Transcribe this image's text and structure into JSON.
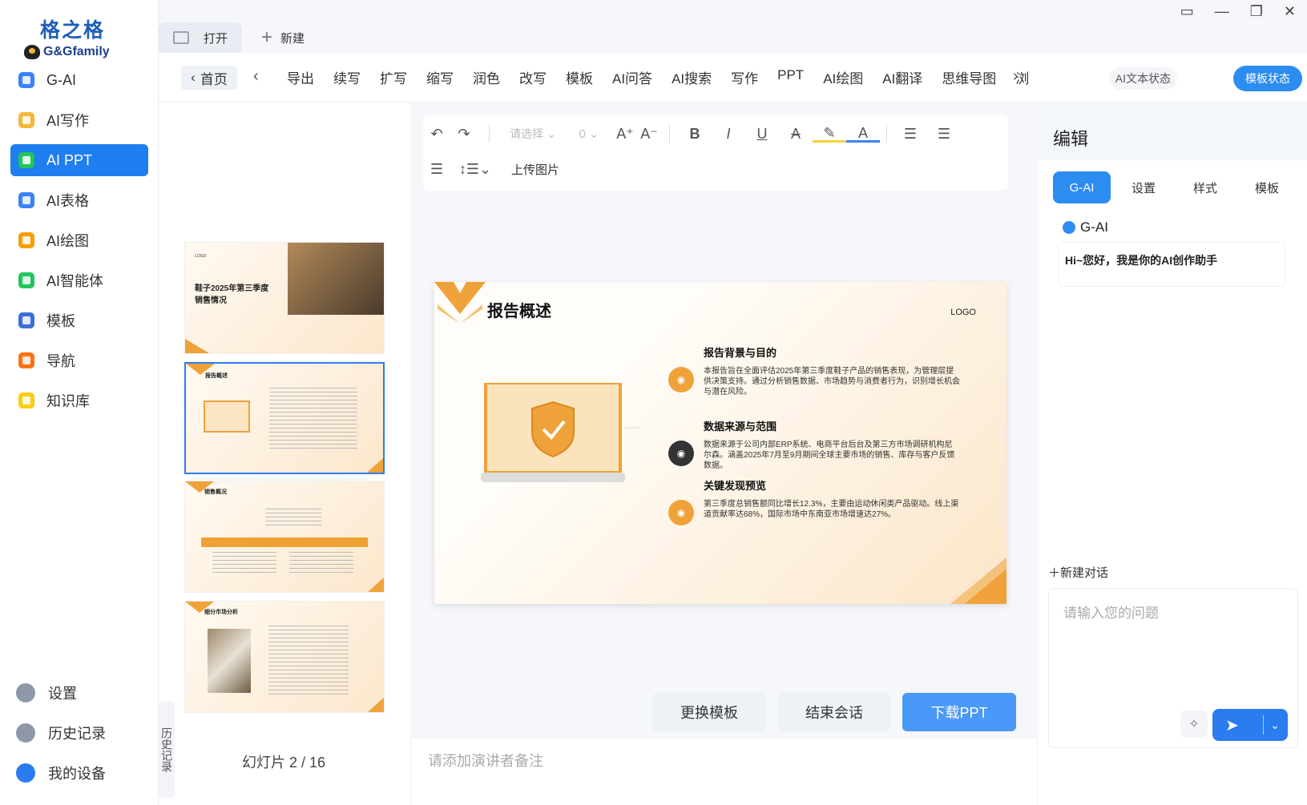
{
  "app": {
    "logo_cn": "格之格",
    "logo_en": "G&Gfamily"
  },
  "sidebar": {
    "items": [
      {
        "label": "G-AI",
        "icon": "g-ai-icon",
        "color": "#3b82f6"
      },
      {
        "label": "AI写作",
        "icon": "writing-icon",
        "color": "#f5b83d"
      },
      {
        "label": "AI PPT",
        "icon": "ppt-icon",
        "color": "#22c55e"
      },
      {
        "label": "AI表格",
        "icon": "table-icon",
        "color": "#3b82f6"
      },
      {
        "label": "AI绘图",
        "icon": "paint-icon",
        "color": "#f59e0b"
      },
      {
        "label": "AI智能体",
        "icon": "robot-icon",
        "color": "#22c55e"
      },
      {
        "label": "模板",
        "icon": "template-icon",
        "color": "#3b6fd8"
      },
      {
        "label": "导航",
        "icon": "navigation-icon",
        "color": "#f97316"
      },
      {
        "label": "知识库",
        "icon": "bulb-icon",
        "color": "#facc15"
      }
    ],
    "bottom": [
      {
        "label": "设置",
        "icon": "gear-icon"
      },
      {
        "label": "历史记录",
        "icon": "history-icon"
      },
      {
        "label": "我的设备",
        "icon": "device-icon"
      }
    ]
  },
  "tabs": {
    "open": "打开",
    "new": "新建"
  },
  "toolbar": {
    "home": "首页",
    "items": [
      "导出",
      "续写",
      "扩写",
      "缩写",
      "润色",
      "改写",
      "模板",
      "AI问答",
      "AI搜索",
      "写作",
      "PPT",
      "AI绘图",
      "AI翻译",
      "思维导图",
      "浏"
    ],
    "status": "AI文本状态",
    "template_status": "模板状态"
  },
  "thumbs": {
    "slide1": {
      "title": "鞋子2025年第三季度销售情况",
      "logo": "LOGO"
    },
    "slide2": {
      "title": "报告概述"
    },
    "slide3": {
      "title": "销售概况"
    },
    "slide4": {
      "title": "细分市场分析"
    },
    "history_tab": "历史记录",
    "counter": "幻灯片 2 / 16"
  },
  "format": {
    "select_placeholder": "请选择",
    "font_size": "0",
    "upload": "上传图片"
  },
  "slide": {
    "title": "报告概述",
    "logo": "LOGO",
    "items": [
      {
        "heading": "报告背景与目的",
        "text": "本报告旨在全面评估2025年第三季度鞋子产品的销售表现，为管理层提供决策支持。通过分析销售数据、市场趋势与消费者行为，识别增长机会与潜在风险。",
        "color": "#f0a23a"
      },
      {
        "heading": "数据来源与范围",
        "text": "数据来源于公司内部ERP系统、电商平台后台及第三方市场调研机构尼尔森。涵盖2025年7月至9月期间全球主要市场的销售、库存与客户反馈数据。",
        "color": "#333333"
      },
      {
        "heading": "关键发现预览",
        "text": "第三季度总销售额同比增长12.3%，主要由运动休闲类产品驱动。线上渠道贡献率达68%，国际市场中东南亚市场增速达27%。",
        "color": "#f0a23a"
      }
    ]
  },
  "actions": {
    "change_template": "更换模板",
    "end_session": "结束会话",
    "download": "下载PPT"
  },
  "notes": {
    "placeholder": "请添加演讲者备注"
  },
  "right": {
    "title": "编辑",
    "tabs": [
      "G-AI",
      "设置",
      "样式",
      "模板"
    ],
    "agent": "G-AI",
    "greeting": "Hi~您好，我是你的AI创作助手",
    "new_chat": "新建对话",
    "input_placeholder": "请输入您的问题"
  }
}
